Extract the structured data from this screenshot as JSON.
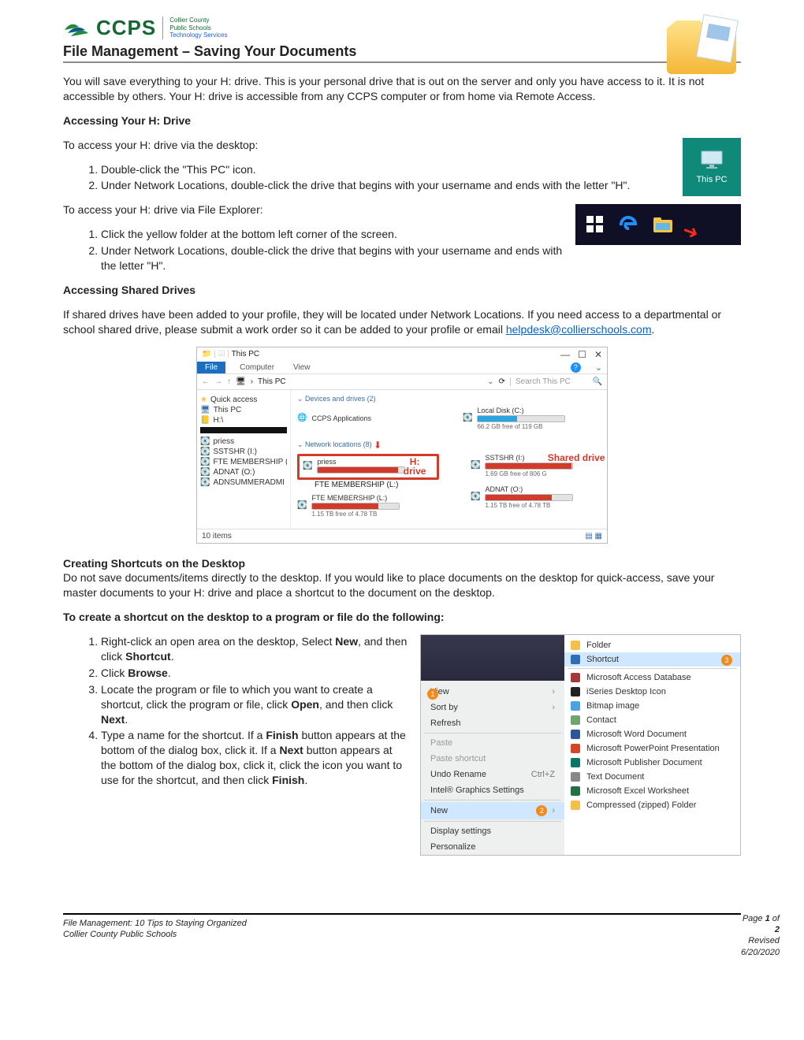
{
  "header": {
    "org_abbrev": "CCPS",
    "org_line1": "Collier County",
    "org_line2": "Public Schools",
    "org_line3": "Technology Services",
    "doc_title": "File Management – Saving Your Documents"
  },
  "intro": "You will save everything to your H: drive.  This is your personal drive that is out on the server and only you have access to it.  It is not accessible by others.  Your H: drive is accessible from any CCPS computer or from home via Remote Access.",
  "s1": {
    "heading": "Accessing Your H: Drive",
    "via_desktop_intro": "To access your H: drive via the desktop:",
    "via_desktop": [
      "Double-click the \"This PC\" icon.",
      "Under Network Locations, double-click the drive that begins with your username and ends with the letter \"H\"."
    ],
    "via_explorer_intro": "To access your H: drive via File Explorer:",
    "via_explorer": [
      "Click the yellow folder at the bottom left corner of the screen.",
      "Under Network Locations, double-click the drive that begins with your username and ends with the letter \"H\"."
    ],
    "thispc_label": "This PC"
  },
  "s2": {
    "heading": "Accessing Shared Drives",
    "body_before_link": "If shared drives have been added to your profile, they will be located under Network Locations.  If you need access to a departmental or school shared drive, please submit a work order so it can be added to your profile or email ",
    "email": "helpdesk@collierschools.com",
    "body_after_link": "."
  },
  "explorer": {
    "window_title": "This PC",
    "tab_file": "File",
    "tab_computer": "Computer",
    "tab_view": "View",
    "crumb": "This PC",
    "refresh_glyph": "⟳",
    "search_placeholder": "Search This PC",
    "nav": {
      "quick_access": "Quick access",
      "this_pc": "This PC",
      "h_drive": "H:\\",
      "items": [
        "priess",
        "SSTSHR (I:)",
        "FTE MEMBERSHIP (L",
        "ADNAT (O:)",
        "ADNSUMMERADMI"
      ]
    },
    "group_devices": "Devices and drives (2)",
    "group_network": "Network locations (8)",
    "drives": {
      "ccps_apps": {
        "name": "CCPS Applications"
      },
      "local_c": {
        "name": "Local Disk (C:)",
        "sub": "66.2 GB free of 119 GB",
        "fill": 45
      },
      "priess": {
        "name": "priess",
        "ann1": "H:",
        "ann2": "drive",
        "sub": "FTE MEMBERSHIP (L:)"
      },
      "sstshr": {
        "name": "SSTSHR (I:)",
        "ann": "Shared drive",
        "sub": "1.69 GB free of 806 G",
        "fill": 99
      },
      "ftel": {
        "name": "FTE MEMBERSHIP (L:)",
        "sub": "1.15 TB free of 4.78 TB",
        "fill": 76
      },
      "adnat": {
        "name": "ADNAT (O:)",
        "sub": "1.15 TB free of 4.78 TB",
        "fill": 76
      }
    },
    "status": "10 items"
  },
  "s3": {
    "heading": "Creating Shortcuts on the Desktop",
    "body": "Do not save documents/items directly to the desktop.  If you would like to place documents on the desktop for quick-access, save your master documents to your H: drive and place a shortcut to the document on the desktop.",
    "subheading": "To create a shortcut on the desktop to a program or file do the following:",
    "steps_html": [
      "Right-click an open area on the desktop, Select <b>New</b>, and then click <b>Shortcut</b>.",
      "Click <b>Browse</b>.",
      "Locate the program or file to which you want to create a shortcut, click the program or file, click <b>Open</b>, and then click <b>Next</b>.",
      "Type a name for the shortcut. If a <b>Finish</b> button appears at the bottom of the dialog box, click it. If a <b>Next</b> button appears at the bottom of the dialog box, click it, click the icon you want to use for the shortcut, and then click <b>Finish</b>."
    ]
  },
  "context_menu": {
    "left": [
      {
        "label": "View",
        "chev": true
      },
      {
        "label": "Sort by",
        "chev": true
      },
      {
        "label": "Refresh"
      },
      {
        "sep": true
      },
      {
        "label": "Paste",
        "disabled": true
      },
      {
        "label": "Paste shortcut",
        "disabled": true
      },
      {
        "label": "Undo Rename",
        "accel": "Ctrl+Z"
      },
      {
        "label": "Intel® Graphics Settings"
      },
      {
        "sep": true
      },
      {
        "label": "New",
        "hover": true,
        "chev": true,
        "badge": "2"
      },
      {
        "sep": true
      },
      {
        "label": "Display settings"
      },
      {
        "label": "Personalize"
      }
    ],
    "left_badge_1": "1",
    "right": [
      {
        "label": "Folder",
        "color": "#f3c04a"
      },
      {
        "label": "Shortcut",
        "hover": true,
        "badge": "3",
        "color": "#2c6fb5"
      },
      {
        "sep": true
      },
      {
        "label": "Microsoft Access Database",
        "color": "#a4373a"
      },
      {
        "label": "iSeries Desktop Icon",
        "color": "#222"
      },
      {
        "label": "Bitmap image",
        "color": "#4aa3df"
      },
      {
        "label": "Contact",
        "color": "#6fa56f"
      },
      {
        "label": "Microsoft Word Document",
        "color": "#2b579a"
      },
      {
        "label": "Microsoft PowerPoint Presentation",
        "color": "#d24726"
      },
      {
        "label": "Microsoft Publisher Document",
        "color": "#077568"
      },
      {
        "label": "Text Document",
        "color": "#888"
      },
      {
        "label": "Microsoft Excel Worksheet",
        "color": "#217346"
      },
      {
        "label": "Compressed (zipped) Folder",
        "color": "#f3c04a"
      }
    ]
  },
  "footer": {
    "left1": "File Management:  10 Tips to Staying Organized",
    "left2": "Collier County Public Schools",
    "right1_pre": "Page ",
    "right1_b": "1",
    "right1_mid": " of ",
    "right1_b2": "2",
    "right2": "Revised 6/20/2020"
  }
}
